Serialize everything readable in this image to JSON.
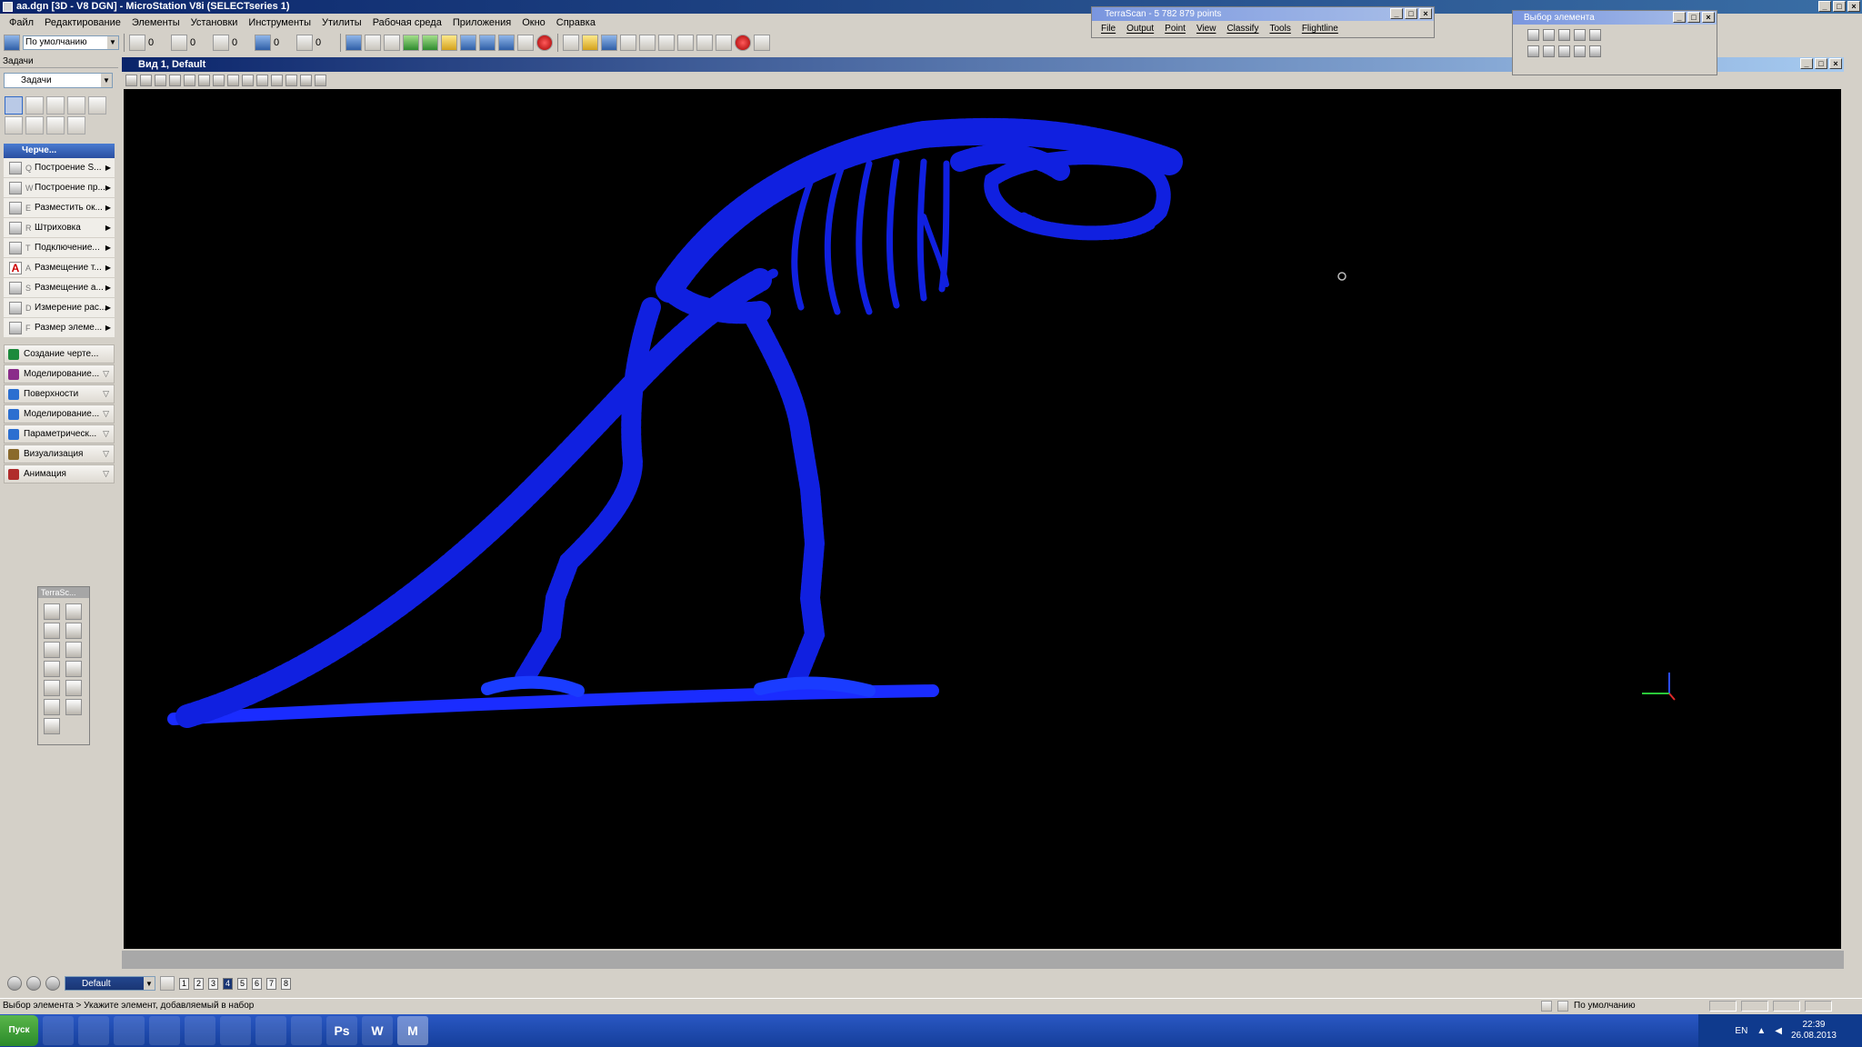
{
  "window": {
    "title": "aa.dgn [3D - V8 DGN] - MicroStation V8i (SELECTseries 1)"
  },
  "menu": [
    "Файл",
    "Редактирование",
    "Элементы",
    "Установки",
    "Инструменты",
    "Утилиты",
    "Рабочая среда",
    "Приложения",
    "Окно",
    "Справка"
  ],
  "toolbar": {
    "active_level": "По умолчанию",
    "values": [
      "0",
      "0",
      "0",
      "0",
      "0"
    ]
  },
  "tasks": {
    "panel_title": "Задачи",
    "dropdown": "Задачи",
    "drawing_group": "Черче...",
    "items": [
      {
        "key": "Q",
        "label": "Построение S..."
      },
      {
        "key": "W",
        "label": "Построение пр..."
      },
      {
        "key": "E",
        "label": "Разместить ок..."
      },
      {
        "key": "R",
        "label": "Штриховка"
      },
      {
        "key": "T",
        "label": "Подключение..."
      },
      {
        "key": "A",
        "label": "Размещение т..."
      },
      {
        "key": "S",
        "label": "Размещение а..."
      },
      {
        "key": "D",
        "label": "Измерение рас..."
      },
      {
        "key": "F",
        "label": "Размер элеме..."
      }
    ],
    "sections": [
      {
        "label": "Создание черте...",
        "color": "#1c8a3c"
      },
      {
        "label": "Моделирование...",
        "color": "#8a2c8a"
      },
      {
        "label": "Поверхности",
        "color": "#2c6fd0"
      },
      {
        "label": "Моделирование...",
        "color": "#2c6fd0"
      },
      {
        "label": "Параметрическ...",
        "color": "#2c6fd0"
      },
      {
        "label": "Визуализация",
        "color": "#8a6a2c"
      },
      {
        "label": "Анимация",
        "color": "#b02c2c"
      }
    ]
  },
  "terra_toolbox": {
    "title": "TerraSc..."
  },
  "view": {
    "title": "Вид 1, Default"
  },
  "terrascan": {
    "title": "TerraScan - 5 782 879 points",
    "menu": [
      "File",
      "Output",
      "Point",
      "View",
      "Classify",
      "Tools",
      "Flightline"
    ]
  },
  "element_selection": {
    "title": "Выбор элемента"
  },
  "view_controls": {
    "model": "Default",
    "view_numbers": [
      "1",
      "2",
      "3",
      "4",
      "5",
      "6",
      "7",
      "8"
    ]
  },
  "status": {
    "message": "Выбор элемента > Укажите элемент, добавляемый в набор",
    "level": "По умолчанию"
  },
  "taskbar": {
    "start": "Пуск",
    "apps": [
      "explorer",
      "folder",
      "media",
      "chrome",
      "save",
      "thunderbird",
      "excel",
      "globe",
      "Ps",
      "W",
      "M"
    ],
    "language": "EN",
    "time": "22:39",
    "date": "26.08.2013"
  }
}
